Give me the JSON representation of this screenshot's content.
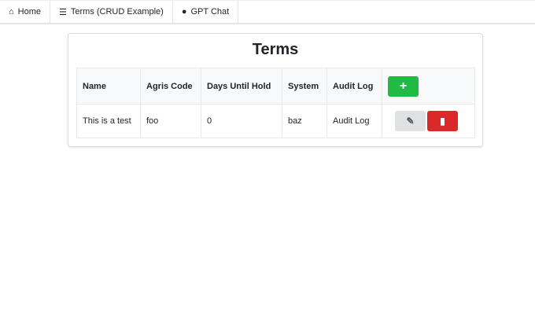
{
  "nav": {
    "items": [
      {
        "label": "Home",
        "icon": "home-icon"
      },
      {
        "label": "Terms (CRUD Example)",
        "icon": "list-icon"
      },
      {
        "label": "GPT Chat",
        "icon": "chat-icon"
      }
    ]
  },
  "page": {
    "title": "Terms"
  },
  "table": {
    "headers": [
      "Name",
      "Agris Code",
      "Days Until Hold",
      "System",
      "Audit Log"
    ],
    "rows": [
      {
        "name": "This is a test",
        "agris_code": "foo",
        "days_until_hold": "0",
        "system": "baz",
        "audit_log": "Audit Log"
      }
    ]
  },
  "colors": {
    "add": "#21ba45",
    "delete": "#db2828",
    "edit": "#e0e1e2"
  }
}
